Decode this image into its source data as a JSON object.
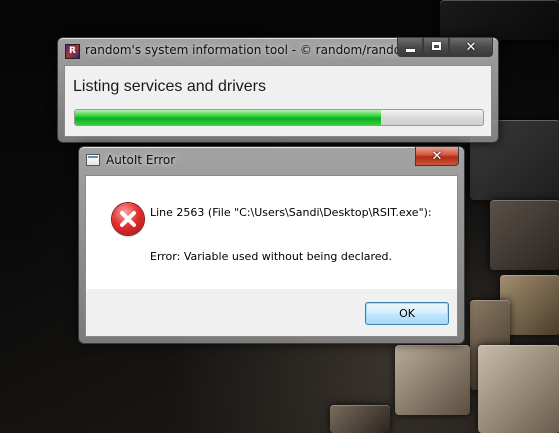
{
  "rsit_window": {
    "title": "random's system information tool - © random/random",
    "status_text": "Listing services and drivers",
    "progress_fraction": 0.75,
    "minimize_label": "",
    "maximize_label": "",
    "close_label": "✕"
  },
  "error_dialog": {
    "title": "AutoIt Error",
    "line1": "Line 2563  (File \"C:\\Users\\Sandi\\Desktop\\RSIT.exe\"):",
    "line2": "Error: Variable used without being declared.",
    "ok_label": "OK",
    "close_label": "✕"
  },
  "colors": {
    "progress_green": "#06b025",
    "close_red": "#c8583c",
    "error_red": "#e23131"
  },
  "icons": {
    "rsit_app_icon": "rsit-app-icon",
    "dialog_app_icon": "window-app-icon",
    "error_icon": "error-icon"
  }
}
